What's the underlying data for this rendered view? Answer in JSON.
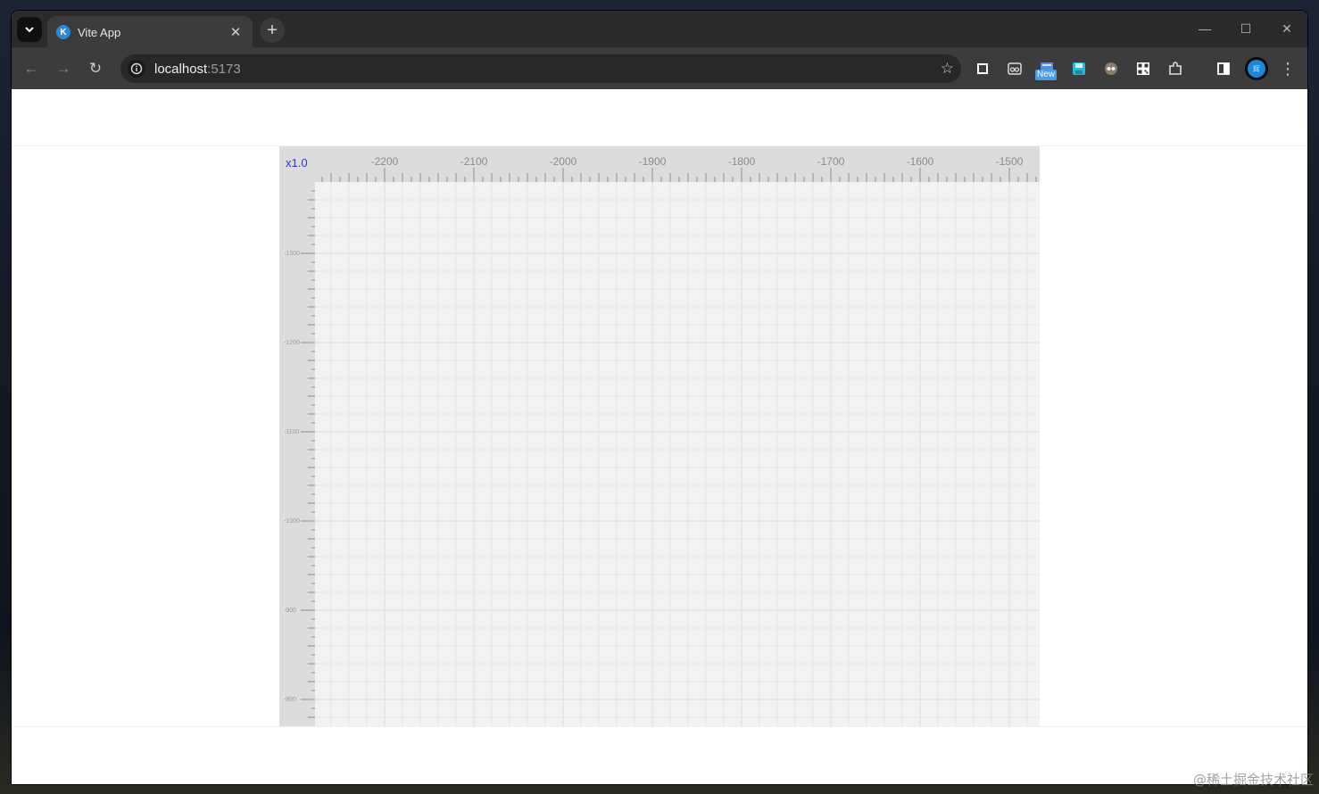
{
  "browser": {
    "tab_title": "Vite App",
    "favicon_letter": "K",
    "url_host": "localhost",
    "url_port": ":5173",
    "new_badge": "New",
    "avatar_text": "辉"
  },
  "ruler": {
    "zoom_label": "x1.0",
    "top_ticks": [
      "-2200",
      "-2100",
      "-2000",
      "-1900",
      "-1800",
      "-1700",
      "-1600",
      "-1500"
    ],
    "left_ticks": [
      "-1300",
      "-1200",
      "-1100",
      "-1000",
      "-900",
      "-800"
    ],
    "zoom_color": "#3333cc",
    "ruler_bg": "#dcdcdc",
    "canvas_bg": "#f2f2f2",
    "grid_color": "#e0e0e0"
  },
  "watermark": "@稀土掘金技术社区"
}
